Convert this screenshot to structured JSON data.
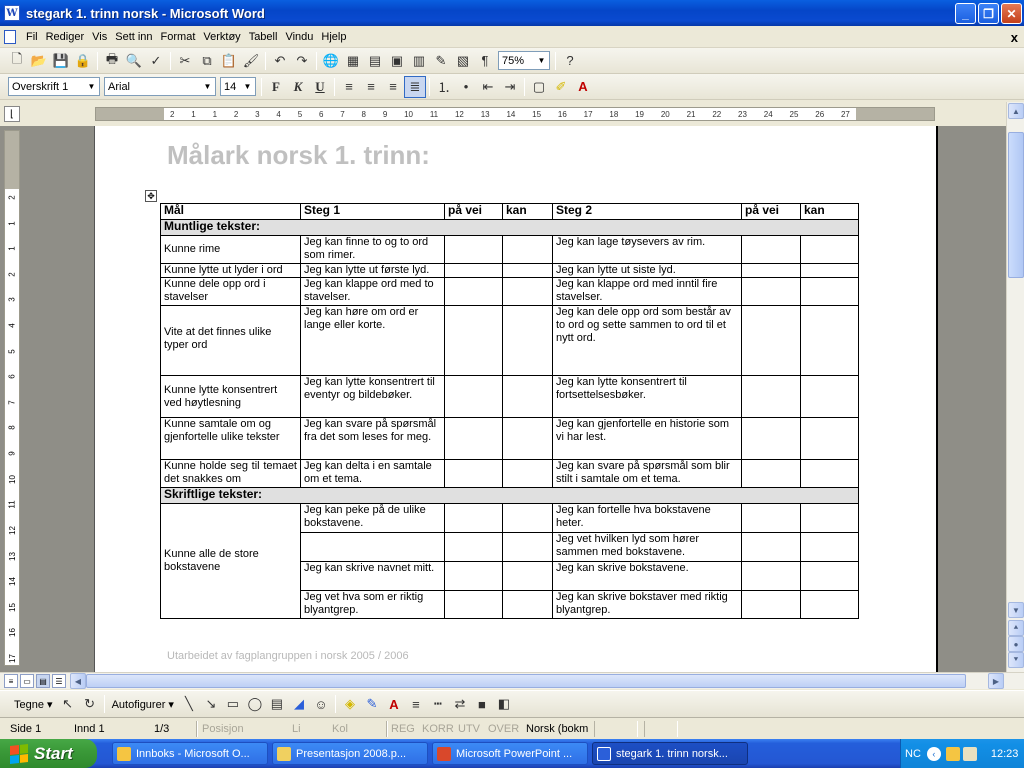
{
  "window": {
    "app_icon": "W",
    "title": "stegark 1. trinn norsk - Microsoft Word",
    "minimize_glyph": "_",
    "maximize_glyph": "❐",
    "close_glyph": "✕"
  },
  "menu": {
    "items": [
      "Fil",
      "Rediger",
      "Vis",
      "Sett inn",
      "Format",
      "Verktøy",
      "Tabell",
      "Vindu",
      "Hjelp"
    ],
    "close_glyph": "x"
  },
  "standard_toolbar": {
    "zoom": "75%"
  },
  "format_toolbar": {
    "style": "Overskrift 1",
    "font": "Arial",
    "size": "14",
    "bold": "F",
    "italic": "K",
    "underline": "U"
  },
  "ruler": {
    "marks": [
      "2",
      "1",
      "1",
      "2",
      "3",
      "4",
      "5",
      "6",
      "7",
      "8",
      "9",
      "10",
      "11",
      "12",
      "13",
      "14",
      "15",
      "16",
      "17",
      "18",
      "19",
      "20",
      "21",
      "22",
      "23",
      "24",
      "25",
      "26",
      "27"
    ],
    "vmarks": [
      "2",
      "1",
      "1",
      "2",
      "3",
      "4",
      "5",
      "6",
      "7",
      "8",
      "9",
      "10",
      "11",
      "12",
      "13",
      "14",
      "15",
      "16",
      "17"
    ]
  },
  "document": {
    "title": "Målark norsk 1. trinn:",
    "footer": "Utarbeidet av fagplangruppen i norsk 2005 / 2006",
    "headers": [
      "Mål",
      "Steg 1",
      "på vei",
      "kan",
      "Steg 2",
      "på vei",
      "kan"
    ],
    "section1": "Muntlige tekster:",
    "section2": "Skriftlige tekster:",
    "rows_oral": [
      {
        "goal": "Kunne rime",
        "step1": "Jeg kan finne to og to ord som rimer.",
        "step2": "Jeg kan lage tøysevers av rim."
      },
      {
        "goal": "Kunne lytte ut lyder i ord",
        "step1": "Jeg kan lytte ut første lyd.",
        "step2": "Jeg kan lytte ut siste lyd."
      },
      {
        "goal": "Kunne dele opp ord i stavelser",
        "step1": "Jeg kan klappe ord med to stavelser.",
        "step2": "Jeg kan klappe ord med inntil fire stavelser."
      },
      {
        "goal": "Vite at det finnes ulike typer ord",
        "step1": "Jeg kan høre om ord er lange eller korte.",
        "step2": "Jeg kan dele opp ord som består av to ord og sette sammen to ord til et nytt ord."
      },
      {
        "goal": "Kunne lytte konsentrert ved høytlesning",
        "step1": "Jeg kan lytte konsentrert til eventyr og bildebøker.",
        "step2": "Jeg kan lytte konsentrert til fortsettelsesbøker."
      },
      {
        "goal": "Kunne samtale om og gjenfortelle ulike tekster",
        "step1": "Jeg kan svare på spørsmål fra det som leses for meg.",
        "step2": "Jeg kan gjenfortelle en historie som vi har lest."
      },
      {
        "goal": "Kunne holde seg til temaet det snakkes om",
        "step1": "Jeg kan delta i en samtale om et tema.",
        "step2": "Jeg kan svare på spørsmål som blir stilt i samtale om et tema."
      }
    ],
    "written_goal": "Kunne alle de store bokstavene",
    "rows_written": [
      {
        "step1": "Jeg kan peke på de ulike bokstavene.",
        "step2": "Jeg kan fortelle hva bokstavene heter."
      },
      {
        "step1": "",
        "step2": "Jeg vet hvilken lyd som hører sammen med bokstavene."
      },
      {
        "step1": "Jeg kan skrive navnet mitt.",
        "step2": "Jeg kan skrive bokstavene."
      },
      {
        "step1": "Jeg vet hva som er riktig blyantgrep.",
        "step2": "Jeg kan skrive bokstaver med riktig blyantgrep."
      }
    ]
  },
  "drawing_toolbar": {
    "draw": "Tegne ▾",
    "autoshapes": "Autofigurer ▾"
  },
  "status": {
    "page": "Side 1",
    "section": "Innd 1",
    "pages": "1/3",
    "position": "Posisjon",
    "line": "Li",
    "col": "Kol",
    "rec": "REG",
    "trk": "KORR",
    "ext": "UTV",
    "ovr": "OVER",
    "language": "Norsk (bokm"
  },
  "taskbar": {
    "start": "Start",
    "items": [
      {
        "label": "Innboks - Microsoft O...",
        "color": "#f5c542"
      },
      {
        "label": "Presentasjon 2008.p...",
        "color": "#f0d060"
      },
      {
        "label": "Microsoft PowerPoint ...",
        "color": "#d9482b"
      },
      {
        "label": "stegark 1. trinn norsk...",
        "color": "#2b5fd9"
      }
    ],
    "lang": "NC",
    "clock": "12:23"
  }
}
